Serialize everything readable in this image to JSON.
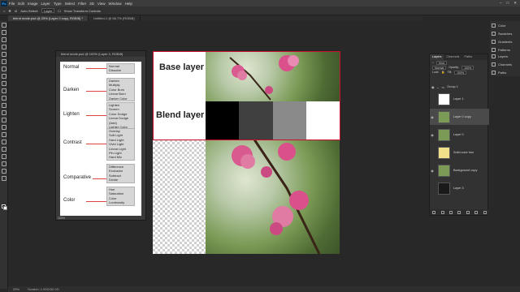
{
  "menubar": {
    "logo": "Ps",
    "items": [
      "File",
      "Edit",
      "Image",
      "Layer",
      "Type",
      "Select",
      "Filter",
      "3D",
      "View",
      "Window",
      "Help"
    ],
    "window_controls": [
      "–",
      "□",
      "✕"
    ]
  },
  "options": {
    "auto_select": "Auto-Select:",
    "auto_select_value": "Layer",
    "show_transform": "Show Transform Controls"
  },
  "tabs": [
    {
      "label": "blend mode.psd @ 25% (Layer 0 copy, RGB/8) *"
    },
    {
      "label": "Untitled-1 @ 66.7% (RGB/8)"
    }
  ],
  "floating": {
    "title": "blend mode.psd @ 100% (Layer 4, RGB/8)",
    "zoom": "100%",
    "groups": [
      {
        "category": "Normal",
        "modes": [
          "Normal",
          "Dissolve"
        ]
      },
      {
        "category": "Darken",
        "modes": [
          "Darken",
          "Multiply",
          "Color Burn",
          "Linear Burn",
          "Darker Color"
        ]
      },
      {
        "category": "Lighten",
        "modes": [
          "Lighten",
          "Screen",
          "Color Dodge",
          "Linear Dodge (Add)",
          "Lighter Color"
        ]
      },
      {
        "category": "Contrast",
        "modes": [
          "Overlay",
          "Soft Light",
          "Hard Light",
          "Vivid Light",
          "Linear Light",
          "Pin Light",
          "Hard Mix"
        ]
      },
      {
        "category": "Comparative",
        "modes": [
          "Difference",
          "Exclusion",
          "Subtract",
          "Divide"
        ]
      },
      {
        "category": "Color",
        "modes": [
          "Hue",
          "Saturation",
          "Color",
          "Luminosity"
        ]
      }
    ]
  },
  "canvas": {
    "base_label": "Base layer",
    "blend_label": "Blend layer",
    "accent": "#c8102e",
    "blend_swatches": [
      "#000000",
      "#404040",
      "#8a8a8a",
      "#ffffff"
    ]
  },
  "right_strip": {
    "items": [
      "Color",
      "Swatches",
      "Gradients",
      "Patterns"
    ],
    "items2": [
      "Layers",
      "Channels",
      "Paths"
    ]
  },
  "layers": {
    "tabs": [
      "Layers",
      "Channels",
      "Paths"
    ],
    "kind": "Kind",
    "blend": "Normal",
    "opacity_label": "Opacity:",
    "opacity": "100%",
    "lock_label": "Lock:",
    "fill_label": "Fill:",
    "fill": "100%",
    "group": "Group 1",
    "items": [
      {
        "name": "Layer 1",
        "thumb": "#ffffff",
        "visible": false,
        "selected": false
      },
      {
        "name": "Layer 0 copy",
        "thumb": "#7a9a55",
        "visible": true,
        "selected": true
      },
      {
        "name": "Layer 0",
        "thumb": "#7a9a55",
        "visible": true,
        "selected": false
      },
      {
        "name": "Solid color fum",
        "thumb": "#f1e08a",
        "visible": false,
        "selected": false
      },
      {
        "name": "Background copy",
        "thumb": "#7a9a55",
        "visible": true,
        "selected": false
      },
      {
        "name": "Layer 3",
        "thumb": "#1a1a1a",
        "visible": false,
        "selected": false
      }
    ]
  },
  "status": {
    "zoom": "25%",
    "doc": "Scratch: 1.00G/32.0G"
  }
}
